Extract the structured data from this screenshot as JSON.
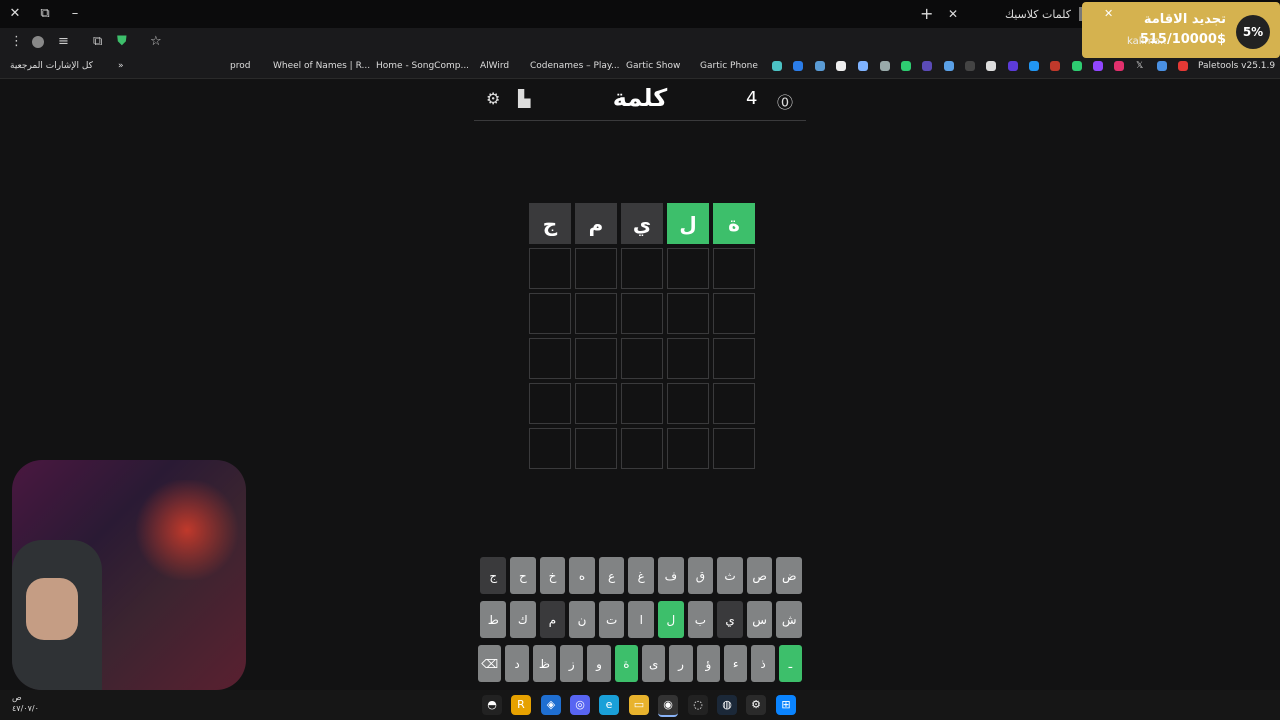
{
  "browser": {
    "tab_title": "كلمات كلاسيك",
    "bookmarks": [
      {
        "label": "Paletools v25.1.9"
      },
      {
        "label": "Gartic Phone"
      },
      {
        "label": "Gartic Show"
      },
      {
        "label": "Codenames – Play..."
      },
      {
        "label": "AlWird"
      },
      {
        "label": "Home - SongComp..."
      },
      {
        "label": "Wheel of Names | R..."
      },
      {
        "label": "prod"
      },
      {
        "label": "كل الإشارات المرجعية"
      }
    ]
  },
  "notification": {
    "title": "تجديد الاقامة",
    "amount": "515/10000$",
    "source": "kalima...",
    "percent": "5%"
  },
  "game": {
    "title": "كلمة",
    "count": "4",
    "board": [
      [
        {
          "letter": "ة",
          "state": "correct"
        },
        {
          "letter": "ل",
          "state": "correct"
        },
        {
          "letter": "ي",
          "state": "absent"
        },
        {
          "letter": "م",
          "state": "absent"
        },
        {
          "letter": "ج",
          "state": "absent"
        }
      ],
      [
        {
          "letter": ""
        },
        {
          "letter": ""
        },
        {
          "letter": ""
        },
        {
          "letter": ""
        },
        {
          "letter": ""
        }
      ],
      [
        {
          "letter": ""
        },
        {
          "letter": ""
        },
        {
          "letter": ""
        },
        {
          "letter": ""
        },
        {
          "letter": ""
        }
      ],
      [
        {
          "letter": ""
        },
        {
          "letter": ""
        },
        {
          "letter": ""
        },
        {
          "letter": ""
        },
        {
          "letter": ""
        }
      ],
      [
        {
          "letter": ""
        },
        {
          "letter": ""
        },
        {
          "letter": ""
        },
        {
          "letter": ""
        },
        {
          "letter": ""
        }
      ],
      [
        {
          "letter": ""
        },
        {
          "letter": ""
        },
        {
          "letter": ""
        },
        {
          "letter": ""
        },
        {
          "letter": ""
        }
      ]
    ],
    "keyboard": [
      [
        {
          "k": "ض"
        },
        {
          "k": "ص"
        },
        {
          "k": "ث"
        },
        {
          "k": "ق"
        },
        {
          "k": "ف"
        },
        {
          "k": "غ"
        },
        {
          "k": "ع"
        },
        {
          "k": "ه"
        },
        {
          "k": "خ"
        },
        {
          "k": "ح"
        },
        {
          "k": "ج",
          "state": "absent"
        }
      ],
      [
        {
          "k": "ش"
        },
        {
          "k": "س"
        },
        {
          "k": "ي",
          "state": "absent"
        },
        {
          "k": "ب"
        },
        {
          "k": "ل",
          "state": "correct"
        },
        {
          "k": "ا"
        },
        {
          "k": "ت"
        },
        {
          "k": "ن"
        },
        {
          "k": "م",
          "state": "absent"
        },
        {
          "k": "ك"
        },
        {
          "k": "ط"
        }
      ],
      [
        {
          "k": "ـ",
          "state": "correct"
        },
        {
          "k": "ذ"
        },
        {
          "k": "ء"
        },
        {
          "k": "ؤ"
        },
        {
          "k": "ر"
        },
        {
          "k": "ى"
        },
        {
          "k": "ة",
          "state": "correct"
        },
        {
          "k": "و"
        },
        {
          "k": "ز"
        },
        {
          "k": "ظ"
        },
        {
          "k": "د"
        },
        {
          "k": "⌫"
        }
      ]
    ]
  },
  "taskbar": {
    "clock_line1": "ص",
    "clock_line2": "٤٧/٠٧/٠"
  },
  "colors": {
    "correct": "#3dbf6b",
    "absent": "#3a3a3c",
    "key": "#818384",
    "background": "#121213"
  }
}
